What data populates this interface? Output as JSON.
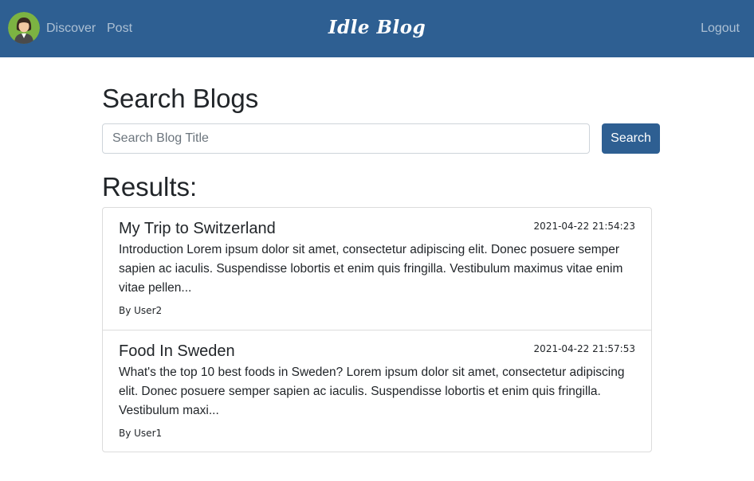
{
  "nav": {
    "discover": "Discover",
    "post": "Post",
    "brand": "Idle Blog",
    "logout": "Logout",
    "avatar_icon": "user-avatar-icon"
  },
  "colors": {
    "navbar_bg": "#2e5f92",
    "primary_button": "#2e5f92"
  },
  "search": {
    "title": "Search Blogs",
    "placeholder": "Search Blog Title",
    "value": "",
    "button_label": "Search"
  },
  "results": {
    "title": "Results:",
    "items": [
      {
        "title": "My Trip to Switzerland",
        "date": "2021-04-22 21:54:23",
        "excerpt": "Introduction Lorem ipsum dolor sit amet, consectetur adipiscing elit. Donec posuere semper sapien ac iaculis. Suspendisse lobortis et enim quis fringilla. Vestibulum maximus vitae enim vitae pellen...",
        "author": "By User2"
      },
      {
        "title": "Food In Sweden",
        "date": "2021-04-22 21:57:53",
        "excerpt": "What's the top 10 best foods in Sweden? Lorem ipsum dolor sit amet, consectetur adipiscing elit. Donec posuere semper sapien ac iaculis. Suspendisse lobortis et enim quis fringilla. Vestibulum maxi...",
        "author": "By User1"
      }
    ]
  }
}
